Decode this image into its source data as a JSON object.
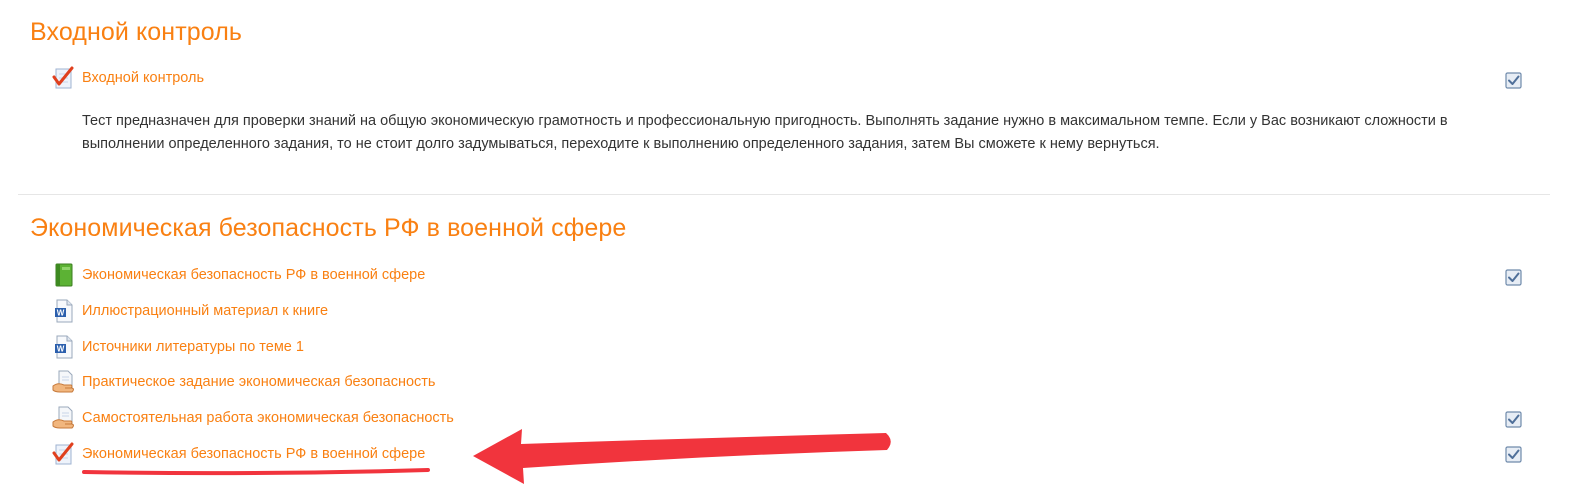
{
  "sections": [
    {
      "title": "Входной контроль",
      "activities": [
        {
          "label": "Входной контроль",
          "icon": "quiz-icon"
        }
      ],
      "description": "Тест предназначен для проверки знаний на общую экономическую грамотность и профессиональную пригодность. Выполнять задание нужно в максимальном темпе. Если у Вас возникают сложности в выполнении определенного задания, то не стоит долго задумываться, переходите к выполнению определенного задания, затем Вы сможете к нему вернуться."
    },
    {
      "title": "Экономическая безопасность РФ в военной сфере",
      "activities": [
        {
          "label": "Экономическая безопасность РФ в военной сфере",
          "icon": "book-icon"
        },
        {
          "label": "Иллюстрационный материал к книге",
          "icon": "word-document-icon"
        },
        {
          "label": "Источники литературы по теме 1",
          "icon": "word-document-icon"
        },
        {
          "label": "Практическое задание экономическая безопасность",
          "icon": "assignment-icon"
        },
        {
          "label": "Самостоятельная работа экономическая безопасность",
          "icon": "assignment-icon"
        },
        {
          "label": "Экономическая безопасность РФ в военной сфере",
          "icon": "quiz-icon"
        }
      ]
    }
  ],
  "completion_checkboxes": [
    "Входной контроль",
    "Экономическая безопасность РФ в военной сфере",
    "Самостоятельная работа экономическая безопасность",
    "Экономическая безопасность РФ в военной сфере"
  ],
  "colors": {
    "accent": "#f98012",
    "text": "#333333",
    "annotation": "#f1343d"
  }
}
